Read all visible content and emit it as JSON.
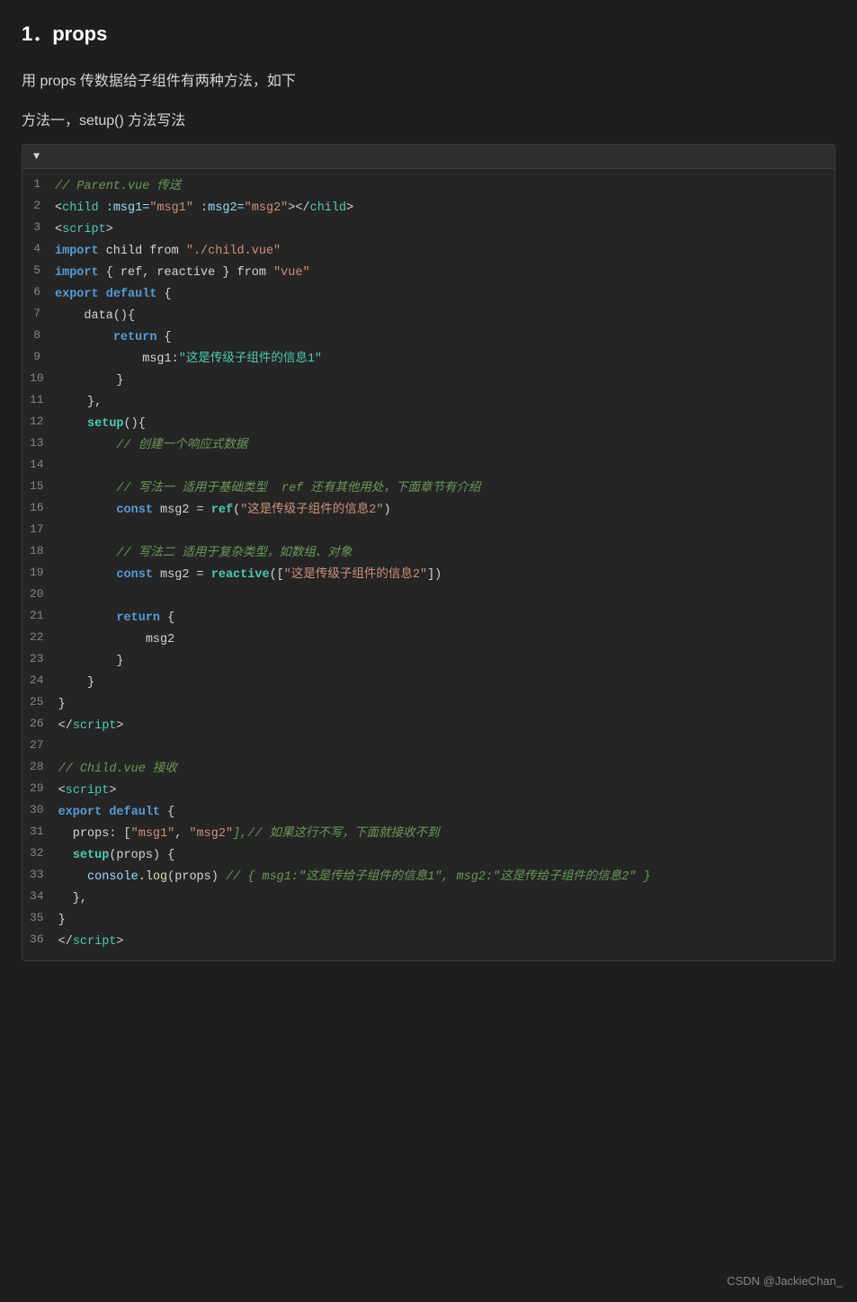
{
  "title": "1．props",
  "desc1": "用 props 传数据给子组件有两种方法，如下",
  "method1": "方法一，setup() 方法写法",
  "code_header_arrow": "▼",
  "watermark": "CSDN @JackieChan_",
  "lines": [
    {
      "num": 1,
      "tokens": [
        {
          "t": "// Parent.vue 传送",
          "c": "c-italic-comment"
        }
      ]
    },
    {
      "num": 2,
      "tokens": [
        {
          "t": "<",
          "c": "c-plain"
        },
        {
          "t": "child",
          "c": "c-tag"
        },
        {
          "t": " :msg1=",
          "c": "c-attr-name"
        },
        {
          "t": "\"msg1\"",
          "c": "c-attr-value"
        },
        {
          "t": " :msg2=",
          "c": "c-attr-name"
        },
        {
          "t": "\"msg2\"",
          "c": "c-attr-value"
        },
        {
          "t": ">",
          "c": "c-plain"
        },
        {
          "t": "</",
          "c": "c-plain"
        },
        {
          "t": "child",
          "c": "c-tag"
        },
        {
          "t": ">",
          "c": "c-plain"
        }
      ]
    },
    {
      "num": 3,
      "tokens": [
        {
          "t": "<",
          "c": "c-plain"
        },
        {
          "t": "script",
          "c": "c-tag"
        },
        {
          "t": ">",
          "c": "c-plain"
        }
      ]
    },
    {
      "num": 4,
      "tokens": [
        {
          "t": "import",
          "c": "c-import-keyword"
        },
        {
          "t": " child ",
          "c": "c-plain"
        },
        {
          "t": "from",
          "c": "c-from"
        },
        {
          "t": " ",
          "c": "c-plain"
        },
        {
          "t": "\"./child.vue\"",
          "c": "c-string"
        }
      ]
    },
    {
      "num": 5,
      "tokens": [
        {
          "t": "import",
          "c": "c-import-keyword"
        },
        {
          "t": " { ref, reactive } ",
          "c": "c-plain"
        },
        {
          "t": "from",
          "c": "c-from"
        },
        {
          "t": " ",
          "c": "c-plain"
        },
        {
          "t": "\"vue\"",
          "c": "c-string"
        }
      ]
    },
    {
      "num": 6,
      "tokens": [
        {
          "t": "export",
          "c": "c-export"
        },
        {
          "t": " ",
          "c": "c-plain"
        },
        {
          "t": "default",
          "c": "c-default-kw"
        },
        {
          "t": " {",
          "c": "c-plain"
        }
      ]
    },
    {
      "num": 7,
      "tokens": [
        {
          "t": "    data(){",
          "c": "c-plain"
        }
      ]
    },
    {
      "num": 8,
      "tokens": [
        {
          "t": "        ",
          "c": "c-plain"
        },
        {
          "t": "return",
          "c": "c-keyword"
        },
        {
          "t": " {",
          "c": "c-plain"
        }
      ]
    },
    {
      "num": 9,
      "tokens": [
        {
          "t": "            msg1:",
          "c": "c-plain"
        },
        {
          "t": "\"这是传级子组件的信息1\"",
          "c": "c-string-cyan"
        }
      ]
    },
    {
      "num": 10,
      "tokens": [
        {
          "t": "        }",
          "c": "c-plain"
        }
      ]
    },
    {
      "num": 11,
      "tokens": [
        {
          "t": "    },",
          "c": "c-plain"
        }
      ]
    },
    {
      "num": 12,
      "tokens": [
        {
          "t": "    ",
          "c": "c-plain"
        },
        {
          "t": "setup",
          "c": "c-reactive"
        },
        {
          "t": "(){",
          "c": "c-plain"
        }
      ]
    },
    {
      "num": 13,
      "tokens": [
        {
          "t": "        // 创建一个响应式数据",
          "c": "c-italic-comment"
        }
      ]
    },
    {
      "num": 14,
      "tokens": []
    },
    {
      "num": 15,
      "tokens": [
        {
          "t": "        // 写法一 适用于基础类型  ref 还有其他用处，下面章节有介绍",
          "c": "c-italic-comment"
        }
      ]
    },
    {
      "num": 16,
      "tokens": [
        {
          "t": "        ",
          "c": "c-plain"
        },
        {
          "t": "const",
          "c": "c-keyword"
        },
        {
          "t": " msg2 = ",
          "c": "c-plain"
        },
        {
          "t": "ref",
          "c": "c-ref"
        },
        {
          "t": "(",
          "c": "c-plain"
        },
        {
          "t": "\"这是传级子组件的信息2\"",
          "c": "c-string"
        },
        {
          "t": ")",
          "c": "c-plain"
        }
      ]
    },
    {
      "num": 17,
      "tokens": []
    },
    {
      "num": 18,
      "tokens": [
        {
          "t": "        // 写法二 适用于复杂类型，如数组、对象",
          "c": "c-italic-comment"
        }
      ]
    },
    {
      "num": 19,
      "tokens": [
        {
          "t": "        ",
          "c": "c-plain"
        },
        {
          "t": "const",
          "c": "c-keyword"
        },
        {
          "t": " msg2 = ",
          "c": "c-plain"
        },
        {
          "t": "reactive",
          "c": "c-reactive"
        },
        {
          "t": "([",
          "c": "c-plain"
        },
        {
          "t": "\"这是传级子组件的信息2\"",
          "c": "c-string"
        },
        {
          "t": "])",
          "c": "c-plain"
        }
      ]
    },
    {
      "num": 20,
      "tokens": []
    },
    {
      "num": 21,
      "tokens": [
        {
          "t": "        ",
          "c": "c-plain"
        },
        {
          "t": "return",
          "c": "c-keyword"
        },
        {
          "t": " {",
          "c": "c-plain"
        }
      ]
    },
    {
      "num": 22,
      "tokens": [
        {
          "t": "            msg2",
          "c": "c-plain"
        }
      ]
    },
    {
      "num": 23,
      "tokens": [
        {
          "t": "        }",
          "c": "c-plain"
        }
      ]
    },
    {
      "num": 24,
      "tokens": [
        {
          "t": "    }",
          "c": "c-plain"
        }
      ]
    },
    {
      "num": 25,
      "tokens": [
        {
          "t": "}",
          "c": "c-plain"
        }
      ]
    },
    {
      "num": 26,
      "tokens": [
        {
          "t": "</",
          "c": "c-plain"
        },
        {
          "t": "script",
          "c": "c-tag"
        },
        {
          "t": ">",
          "c": "c-plain"
        }
      ]
    },
    {
      "num": 27,
      "tokens": []
    },
    {
      "num": 28,
      "tokens": [
        {
          "t": "// Child.vue 接收",
          "c": "c-italic-comment"
        }
      ]
    },
    {
      "num": 29,
      "tokens": [
        {
          "t": "<",
          "c": "c-plain"
        },
        {
          "t": "script",
          "c": "c-tag"
        },
        {
          "t": ">",
          "c": "c-plain"
        }
      ]
    },
    {
      "num": 30,
      "tokens": [
        {
          "t": "export",
          "c": "c-export"
        },
        {
          "t": " ",
          "c": "c-plain"
        },
        {
          "t": "default",
          "c": "c-default-kw"
        },
        {
          "t": " {",
          "c": "c-plain"
        }
      ]
    },
    {
      "num": 31,
      "tokens": [
        {
          "t": "  props: [",
          "c": "c-plain"
        },
        {
          "t": "\"msg1\"",
          "c": "c-props-arr"
        },
        {
          "t": ", ",
          "c": "c-plain"
        },
        {
          "t": "\"msg2\"",
          "c": "c-props-arr"
        },
        {
          "t": "],// 如果这行不写，下面就接收不到",
          "c": "c-italic-comment"
        }
      ]
    },
    {
      "num": 32,
      "tokens": [
        {
          "t": "  ",
          "c": "c-plain"
        },
        {
          "t": "setup",
          "c": "c-reactive"
        },
        {
          "t": "(props) {",
          "c": "c-plain"
        }
      ]
    },
    {
      "num": 33,
      "tokens": [
        {
          "t": "    ",
          "c": "c-plain"
        },
        {
          "t": "console",
          "c": "c-console"
        },
        {
          "t": ".",
          "c": "c-plain"
        },
        {
          "t": "log",
          "c": "c-log"
        },
        {
          "t": "(props) ",
          "c": "c-plain"
        },
        {
          "t": "// { msg1:\"这是传给子组件的信息1\", msg2:\"这是传给子组件的信息2\" }",
          "c": "c-italic-comment"
        }
      ]
    },
    {
      "num": 34,
      "tokens": [
        {
          "t": "  },",
          "c": "c-plain"
        }
      ]
    },
    {
      "num": 35,
      "tokens": [
        {
          "t": "}",
          "c": "c-plain"
        }
      ]
    },
    {
      "num": 36,
      "tokens": [
        {
          "t": "</",
          "c": "c-plain"
        },
        {
          "t": "script",
          "c": "c-tag"
        },
        {
          "t": ">",
          "c": "c-plain"
        }
      ]
    }
  ]
}
